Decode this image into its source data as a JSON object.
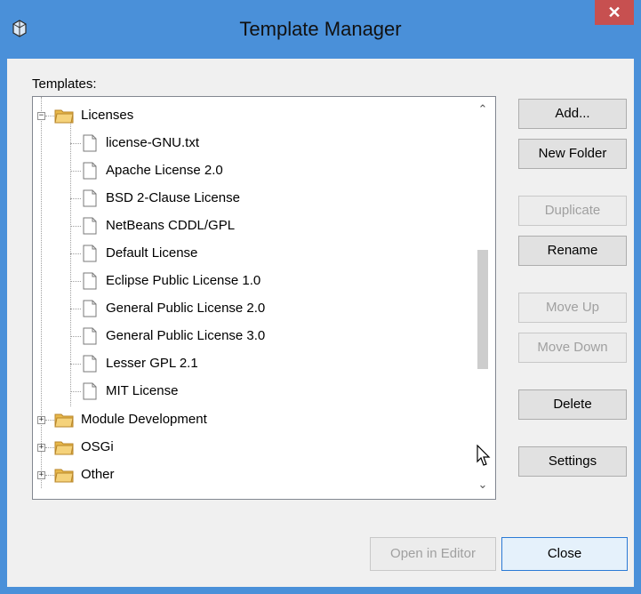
{
  "window": {
    "title": "Template Manager",
    "close_label": "✕",
    "icon": "app-icon"
  },
  "templates_label": "Templates:",
  "tree": {
    "items": [
      {
        "label": "Licenses",
        "type": "folder",
        "expanded": true
      },
      {
        "label": "license-GNU.txt",
        "type": "file"
      },
      {
        "label": "Apache License 2.0",
        "type": "file"
      },
      {
        "label": "BSD 2-Clause License",
        "type": "file"
      },
      {
        "label": "NetBeans CDDL/GPL",
        "type": "file"
      },
      {
        "label": "Default License",
        "type": "file"
      },
      {
        "label": "Eclipse Public License 1.0",
        "type": "file"
      },
      {
        "label": "General Public License 2.0",
        "type": "file"
      },
      {
        "label": "General Public License 3.0",
        "type": "file"
      },
      {
        "label": "Lesser GPL 2.1",
        "type": "file"
      },
      {
        "label": "MIT License",
        "type": "file"
      },
      {
        "label": "Module Development",
        "type": "folder",
        "expanded": false
      },
      {
        "label": "OSGi",
        "type": "folder",
        "expanded": false
      },
      {
        "label": "Other",
        "type": "folder",
        "expanded": false
      }
    ]
  },
  "buttons": {
    "add": "Add...",
    "new_folder": "New Folder",
    "duplicate": "Duplicate",
    "rename": "Rename",
    "move_up": "Move Up",
    "move_down": "Move Down",
    "delete": "Delete",
    "settings": "Settings",
    "open_in_editor": "Open in Editor",
    "close": "Close"
  },
  "colors": {
    "titlebar": "#4a90d9",
    "close_button": "#c75050",
    "dialog_bg": "#f0f0f0",
    "focus_border": "#2b7ad6"
  }
}
